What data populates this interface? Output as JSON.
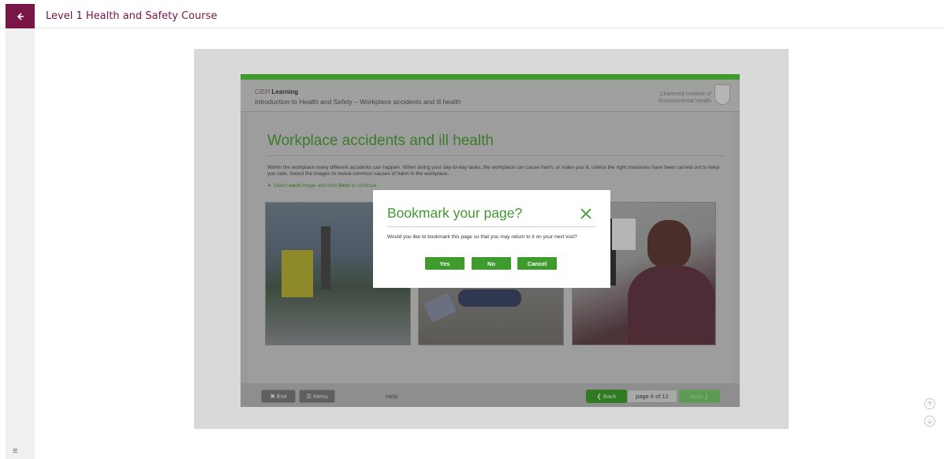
{
  "header": {
    "course_title": "Level 1 Health and Safety Course"
  },
  "course": {
    "brand_prefix": "CIEH",
    "brand_name": "Learning",
    "subtitle": "Introduction to Health and Safety – Workplace accidents and ill health",
    "institute_line1": "Chartered Institute of",
    "institute_line2": "Environmental Health",
    "page_title": "Workplace accidents and ill health",
    "intro_text": "Within the workplace many different accidents can happen. When doing your day-to-day tasks, the workplace can cause harm, or make you ill, unless the right measures have been carried out to keep you safe. Select the images to reveal common causes of harm in the workplace.",
    "instruction_pre": "Select",
    "instruction_each": "each",
    "instruction_mid": "image and then",
    "instruction_next": "Next",
    "instruction_post": "to continue."
  },
  "footer": {
    "exit_label": "Exit",
    "menu_label": "Menu",
    "help_label": "Help",
    "back_label": "Back",
    "page_indicator": "page 6 of 12",
    "next_label": "Next"
  },
  "modal": {
    "title": "Bookmark your page?",
    "message": "Would you like to bookmark this page so that you may return to it on your next visit?",
    "yes_label": "Yes",
    "no_label": "No",
    "cancel_label": "Cancel"
  },
  "colors": {
    "brand": "#7a1547",
    "accent_green": "#3f9b2d"
  },
  "icons": {
    "back": "arrow-left-icon",
    "close": "close-icon",
    "menu": "hamburger-icon",
    "scroll_up": "arrow-up-circle-icon",
    "scroll_down": "arrow-down-circle-icon"
  }
}
